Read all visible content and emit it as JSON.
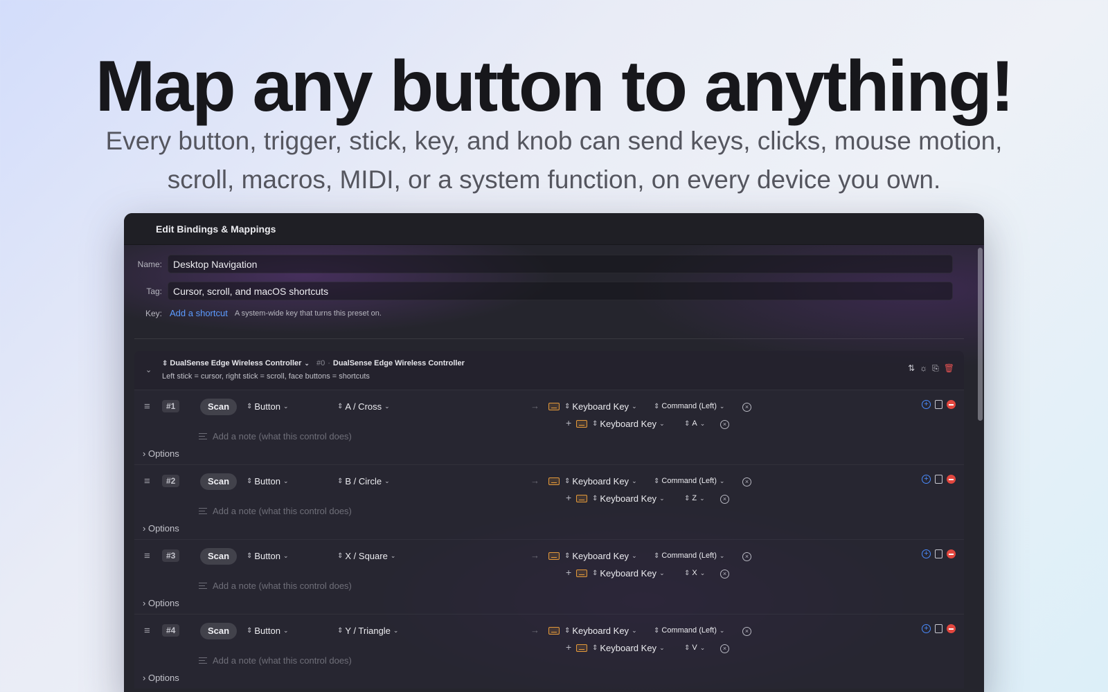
{
  "hero": {
    "title": "Map any button to anything!",
    "subtitle_line1": "Every button, trigger, stick, key, and knob can send keys, clicks, mouse motion,",
    "subtitle_line2": "scroll, macros, MIDI, or a system function, on every device you own."
  },
  "window": {
    "title": "Edit Bindings & Mappings",
    "name_label": "Name:",
    "name_value": "Desktop Navigation",
    "tag_label": "Tag:",
    "tag_value": "Cursor, scroll, and macOS shortcuts",
    "key_label": "Key:",
    "key_link": "Add a shortcut",
    "key_hint": "A system-wide key that turns this preset on."
  },
  "device": {
    "name": "DualSense Edge Wireless Controller",
    "index": "#0",
    "full_name": "DualSense Edge Wireless Controller",
    "description": "Left stick = cursor, right stick = scroll, face buttons = shortcuts"
  },
  "bindings": [
    {
      "number": "#1",
      "scan": "Scan",
      "type": "Button",
      "control": "A / Cross",
      "action1": "Keyboard Key",
      "mod1": "Command (Left)",
      "action2": "Keyboard Key",
      "key2": "A",
      "note_placeholder": "Add a note (what this control does)",
      "options": "Options"
    },
    {
      "number": "#2",
      "scan": "Scan",
      "type": "Button",
      "control": "B / Circle",
      "action1": "Keyboard Key",
      "mod1": "Command (Left)",
      "action2": "Keyboard Key",
      "key2": "Z",
      "note_placeholder": "Add a note (what this control does)",
      "options": "Options"
    },
    {
      "number": "#3",
      "scan": "Scan",
      "type": "Button",
      "control": "X / Square",
      "action1": "Keyboard Key",
      "mod1": "Command (Left)",
      "action2": "Keyboard Key",
      "key2": "X",
      "note_placeholder": "Add a note (what this control does)",
      "options": "Options"
    },
    {
      "number": "#4",
      "scan": "Scan",
      "type": "Button",
      "control": "Y / Triangle",
      "action1": "Keyboard Key",
      "mod1": "Command (Left)",
      "action2": "Keyboard Key",
      "key2": "V",
      "note_placeholder": "Add a note (what this control does)",
      "options": "Options"
    }
  ],
  "colors": {
    "accent_link": "#5c9cff",
    "keyboard_icon": "#e59a3a",
    "remove": "#e2473f",
    "add": "#4a8cff"
  }
}
